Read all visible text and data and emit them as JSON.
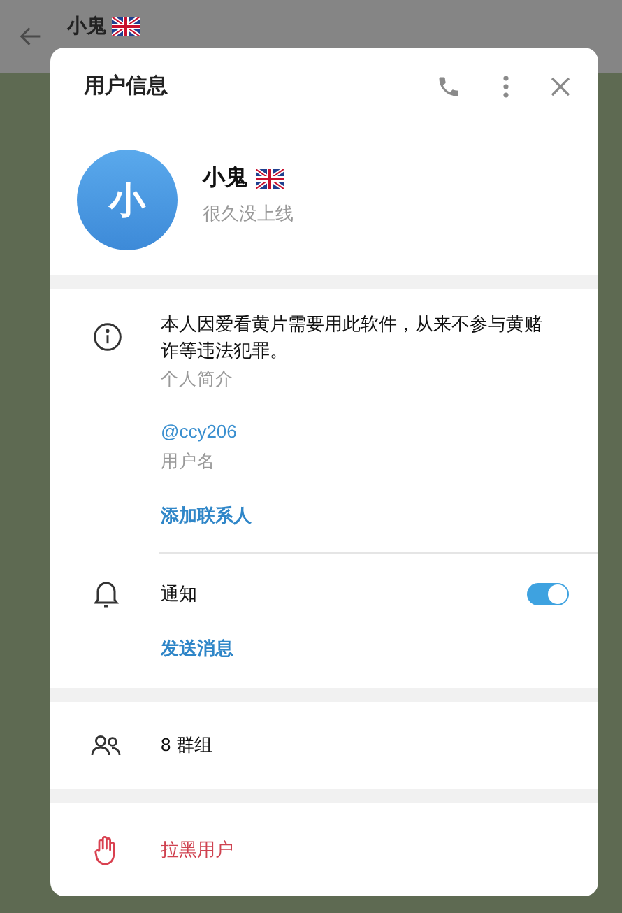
{
  "chat_header": {
    "name": "小鬼"
  },
  "dialog": {
    "title": "用户信息"
  },
  "profile": {
    "avatar_letter": "小",
    "name": "小鬼",
    "status": "很久没上线"
  },
  "bio": {
    "text": "本人因爱看黄片需要用此软件，从来不参与黄赌诈等违法犯罪。",
    "label": "个人简介"
  },
  "username": {
    "value": "@ccy206",
    "label": "用户名"
  },
  "add_contact": "添加联系人",
  "notifications": {
    "label": "通知",
    "on": true
  },
  "send_message": "发送消息",
  "groups": "8 群组",
  "block": "拉黑用户"
}
